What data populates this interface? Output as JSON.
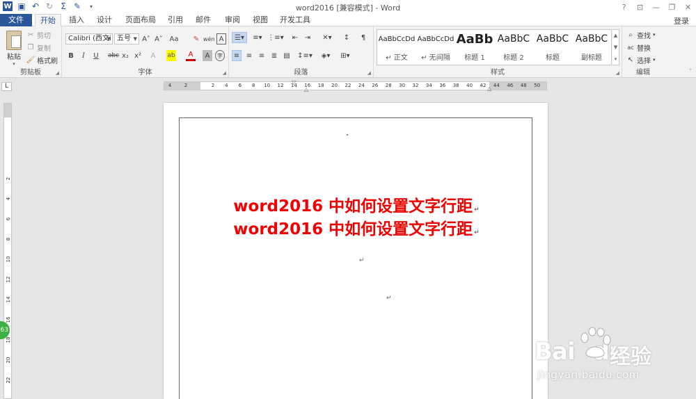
{
  "window": {
    "title": "word2016 [兼容模式] - Word",
    "controls": [
      "?",
      "⊡",
      "—",
      "❐",
      "✕"
    ]
  },
  "qat": {
    "word_icon": "word-logo-icon",
    "save_icon": "save-icon",
    "undo_icon": "undo-icon",
    "redo_icon": "redo-icon",
    "sum_icon": "sigma-icon",
    "edit_icon": "edit-icon"
  },
  "tabs": [
    "文件",
    "开始",
    "插入",
    "设计",
    "页面布局",
    "引用",
    "邮件",
    "审阅",
    "视图",
    "开发工具"
  ],
  "login": "登录",
  "clipboard": {
    "paste": "粘贴",
    "cut": "剪切",
    "copy": "复制",
    "format_painter": "格式刷",
    "label": "剪贴板"
  },
  "font": {
    "name": "Calibri (西文i",
    "size": "五号",
    "label": "字体",
    "grow": "A˄",
    "shrink": "A˅",
    "case": "Aa",
    "clear": "✎",
    "phonetic": "wén",
    "border_char": "A",
    "bold": "B",
    "italic": "I",
    "underline": "U",
    "strike": "abc",
    "sub": "x₂",
    "sup": "x²",
    "effects": "A",
    "highlight": "ab",
    "color": "A",
    "shading": "A",
    "enclose": "字"
  },
  "paragraph": {
    "label": "段落"
  },
  "styles": {
    "label": "样式",
    "items": [
      {
        "sample": "AaBbCcDd",
        "name": "↵ 正文"
      },
      {
        "sample": "AaBbCcDd",
        "name": "↵ 无间隔"
      },
      {
        "sample": "AaBb",
        "name": "标题 1"
      },
      {
        "sample": "AaBbC",
        "name": "标题 2"
      },
      {
        "sample": "AaBbC",
        "name": "标题"
      },
      {
        "sample": "AaBbC",
        "name": "副标题"
      }
    ]
  },
  "editing": {
    "find": "查找",
    "replace": "替换",
    "select": "选择",
    "label": "编辑"
  },
  "ruler": {
    "corner": "L",
    "h_ticks": [
      "4",
      "2",
      "2",
      "4",
      "6",
      "8",
      "10",
      "12",
      "14",
      "16",
      "18",
      "20",
      "22",
      "24",
      "26",
      "28",
      "30",
      "32",
      "34",
      "36",
      "38",
      "40",
      "42",
      "44",
      "46",
      "48",
      "50"
    ],
    "v_ticks": [
      "2",
      "4",
      "6",
      "8",
      "10",
      "12",
      "14",
      "16",
      "18",
      "20",
      "22"
    ]
  },
  "badge": "63",
  "document": {
    "lines": [
      "word2016 中如何设置文字行距",
      "word2016 中如何设置文字行距"
    ],
    "para_mark": "↵"
  },
  "watermark": {
    "brand": "Bai",
    "brand_tail": "du",
    "cn": "经验",
    "url": "jingyan.baidu.com"
  },
  "colors": {
    "accent": "#2b579a",
    "heading_red": "#f00000",
    "badge_green": "#3cb043"
  }
}
